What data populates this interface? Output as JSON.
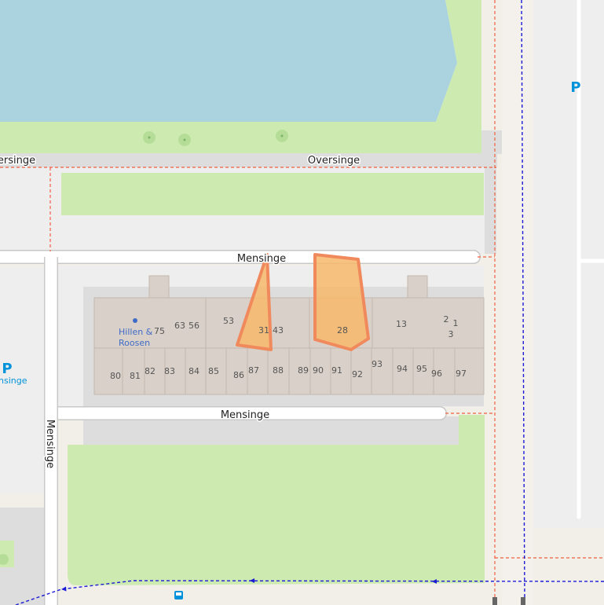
{
  "streets": {
    "oversinge_left": "Oversinge",
    "oversinge_right": "Oversinge",
    "mensinge_north": "Mensinge",
    "mensinge_south": "Mensinge",
    "mensinge_west": "Mensinge"
  },
  "poi": {
    "shop_name_line1": "Hillen &",
    "shop_name_line2": "Roosen"
  },
  "parking": {
    "symbol": "P",
    "west_label": "nsinge"
  },
  "house_numbers": {
    "n75": "75",
    "n63": "63",
    "n56": "56",
    "n53": "53",
    "n31": "31",
    "n43": "43",
    "n28": "28",
    "n13": "13",
    "n2": "2",
    "n1": "1",
    "n3": "3",
    "n80": "80",
    "n81": "81",
    "n82": "82",
    "n83": "83",
    "n84": "84",
    "n85": "85",
    "n86": "86",
    "n87": "87",
    "n88": "88",
    "n89": "89",
    "n90": "90",
    "n91": "91",
    "n92": "92",
    "n93": "93",
    "n94": "94",
    "n95": "95",
    "n96": "96",
    "n97": "97"
  },
  "colors": {
    "water": "#aad3df",
    "grass": "#cdebb0",
    "building": "#d9d0c9",
    "highlight_fill": "#f7b86a",
    "highlight_stroke": "#f08a5d",
    "parking_blue": "#0092da",
    "footway_blue": "#1b1bd6",
    "boundary_red": "#f06040"
  }
}
